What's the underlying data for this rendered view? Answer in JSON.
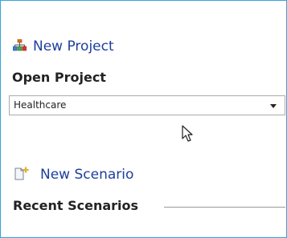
{
  "start_panel": {
    "new_project_label": "New Project",
    "new_project_icon": "org-chart-icon",
    "open_project_heading": "Open Project",
    "project_select": {
      "selected": "Healthcare"
    },
    "new_scenario_label": "New Scenario",
    "new_scenario_icon": "new-document-icon",
    "recent_scenarios_heading": "Recent Scenarios"
  },
  "colors": {
    "frame_border": "#35a3dc",
    "link": "#1c3f9f",
    "heading": "#222222"
  }
}
